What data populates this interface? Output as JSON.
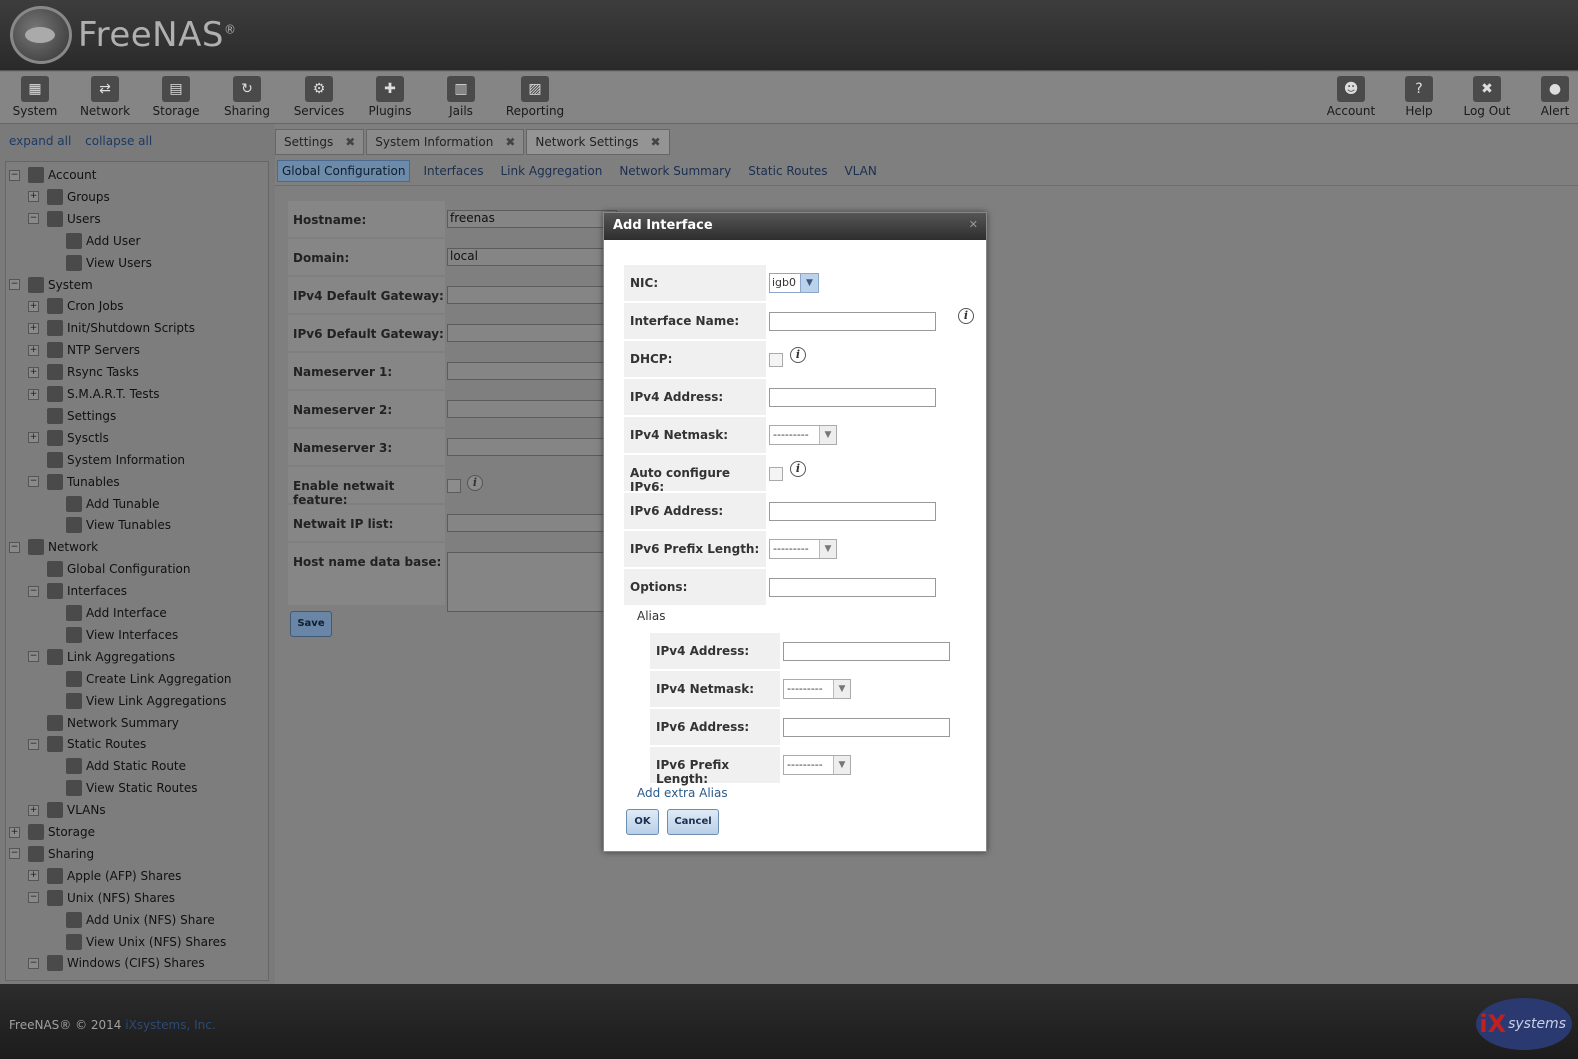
{
  "app": {
    "logo_text": "FreeNAS",
    "logo_reg": "®"
  },
  "topnav": {
    "left": [
      {
        "label": "System",
        "icon": "system-icon",
        "glyph": "▦"
      },
      {
        "label": "Network",
        "icon": "network-icon",
        "glyph": "⇄"
      },
      {
        "label": "Storage",
        "icon": "storage-icon",
        "glyph": "▤"
      },
      {
        "label": "Sharing",
        "icon": "sharing-icon",
        "glyph": "↻"
      },
      {
        "label": "Services",
        "icon": "services-icon",
        "glyph": "⚙"
      },
      {
        "label": "Plugins",
        "icon": "plugins-icon",
        "glyph": "✚"
      },
      {
        "label": "Jails",
        "icon": "jails-icon",
        "glyph": "▥"
      },
      {
        "label": "Reporting",
        "icon": "reporting-icon",
        "glyph": "▨"
      }
    ],
    "right": [
      {
        "label": "Account",
        "icon": "account-icon",
        "glyph": "☻"
      },
      {
        "label": "Help",
        "icon": "help-icon",
        "glyph": "?"
      },
      {
        "label": "Log Out",
        "icon": "logout-icon",
        "glyph": "✖"
      },
      {
        "label": "Alert",
        "icon": "alert-icon",
        "glyph": "●"
      }
    ]
  },
  "sidebar": {
    "expand_all": "expand all",
    "collapse_all": "collapse all",
    "tree": [
      {
        "label": "Account",
        "level": 0,
        "toggle": "−",
        "icon": "account-icon"
      },
      {
        "label": "Groups",
        "level": 1,
        "toggle": "+",
        "icon": "groups-icon"
      },
      {
        "label": "Users",
        "level": 1,
        "toggle": "−",
        "icon": "user-icon"
      },
      {
        "label": "Add User",
        "level": 2,
        "toggle": "",
        "icon": "add-user-icon"
      },
      {
        "label": "View Users",
        "level": 2,
        "toggle": "",
        "icon": "view-users-icon"
      },
      {
        "label": "System",
        "level": 0,
        "toggle": "−",
        "icon": "system-icon"
      },
      {
        "label": "Cron Jobs",
        "level": 1,
        "toggle": "+",
        "icon": "calendar-icon"
      },
      {
        "label": "Init/Shutdown Scripts",
        "level": 1,
        "toggle": "+",
        "icon": "scripts-icon"
      },
      {
        "label": "NTP Servers",
        "level": 1,
        "toggle": "+",
        "icon": "clock-icon"
      },
      {
        "label": "Rsync Tasks",
        "level": 1,
        "toggle": "+",
        "icon": "rsync-icon"
      },
      {
        "label": "S.M.A.R.T. Tests",
        "level": 1,
        "toggle": "+",
        "icon": "smart-icon"
      },
      {
        "label": "Settings",
        "level": 1,
        "toggle": "",
        "icon": "wrench-icon"
      },
      {
        "label": "Sysctls",
        "level": 1,
        "toggle": "+",
        "icon": "sysctl-icon"
      },
      {
        "label": "System Information",
        "level": 1,
        "toggle": "",
        "icon": "info-icon"
      },
      {
        "label": "Tunables",
        "level": 1,
        "toggle": "−",
        "icon": "tunables-icon"
      },
      {
        "label": "Add Tunable",
        "level": 2,
        "toggle": "",
        "icon": "add-tunable-icon"
      },
      {
        "label": "View Tunables",
        "level": 2,
        "toggle": "",
        "icon": "view-tunables-icon"
      },
      {
        "label": "Network",
        "level": 0,
        "toggle": "−",
        "icon": "network-icon"
      },
      {
        "label": "Global Configuration",
        "level": 1,
        "toggle": "",
        "icon": "wrench-icon"
      },
      {
        "label": "Interfaces",
        "level": 1,
        "toggle": "−",
        "icon": "interfaces-icon"
      },
      {
        "label": "Add Interface",
        "level": 2,
        "toggle": "",
        "icon": "add-interface-icon"
      },
      {
        "label": "View Interfaces",
        "level": 2,
        "toggle": "",
        "icon": "view-interfaces-icon"
      },
      {
        "label": "Link Aggregations",
        "level": 1,
        "toggle": "−",
        "icon": "link-aggregation-icon"
      },
      {
        "label": "Create Link Aggregation",
        "level": 2,
        "toggle": "",
        "icon": "create-lagg-icon"
      },
      {
        "label": "View Link Aggregations",
        "level": 2,
        "toggle": "",
        "icon": "view-lagg-icon"
      },
      {
        "label": "Network Summary",
        "level": 1,
        "toggle": "",
        "icon": "wrench-icon"
      },
      {
        "label": "Static Routes",
        "level": 1,
        "toggle": "−",
        "icon": "static-routes-icon"
      },
      {
        "label": "Add Static Route",
        "level": 2,
        "toggle": "",
        "icon": "add-route-icon"
      },
      {
        "label": "View Static Routes",
        "level": 2,
        "toggle": "",
        "icon": "view-routes-icon"
      },
      {
        "label": "VLANs",
        "level": 1,
        "toggle": "+",
        "icon": "vlan-icon"
      },
      {
        "label": "Storage",
        "level": 0,
        "toggle": "+",
        "icon": "storage-icon"
      },
      {
        "label": "Sharing",
        "level": 0,
        "toggle": "−",
        "icon": "sharing-icon"
      },
      {
        "label": "Apple (AFP) Shares",
        "level": 1,
        "toggle": "+",
        "icon": "apple-icon"
      },
      {
        "label": "Unix (NFS) Shares",
        "level": 1,
        "toggle": "−",
        "icon": "unix-icon"
      },
      {
        "label": "Add Unix (NFS) Share",
        "level": 2,
        "toggle": "",
        "icon": "add-nfs-icon"
      },
      {
        "label": "View Unix (NFS) Shares",
        "level": 2,
        "toggle": "",
        "icon": "view-nfs-icon"
      },
      {
        "label": "Windows (CIFS) Shares",
        "level": 1,
        "toggle": "−",
        "icon": "windows-icon"
      }
    ]
  },
  "tabs": [
    {
      "label": "Settings",
      "close": "✖"
    },
    {
      "label": "System Information",
      "close": "✖"
    },
    {
      "label": "Network Settings",
      "close": "✖"
    }
  ],
  "subtabs": [
    "Global Configuration",
    "Interfaces",
    "Link Aggregation",
    "Network Summary",
    "Static Routes",
    "VLAN"
  ],
  "global_config": {
    "fields": [
      {
        "label": "Hostname:",
        "value": "freenas"
      },
      {
        "label": "Domain:",
        "value": "local"
      },
      {
        "label": "IPv4 Default Gateway:",
        "value": ""
      },
      {
        "label": "IPv6 Default Gateway:",
        "value": ""
      },
      {
        "label": "Nameserver 1:",
        "value": ""
      },
      {
        "label": "Nameserver 2:",
        "value": ""
      },
      {
        "label": "Nameserver 3:",
        "value": ""
      },
      {
        "label": "Enable netwait feature:",
        "value": ""
      },
      {
        "label": "Netwait IP list:",
        "value": ""
      },
      {
        "label": "Host name data base:",
        "value": ""
      }
    ],
    "save_label": "Save",
    "info_glyph": "i"
  },
  "modal": {
    "title": "Add Interface",
    "close": "✕",
    "nic_label": "NIC:",
    "nic_value": "igb0",
    "interface_name_label": "Interface Name:",
    "dhcp_label": "DHCP:",
    "ipv4_address_label": "IPv4 Address:",
    "ipv4_netmask_label": "IPv4 Netmask:",
    "auto_ipv6_label": "Auto configure IPv6:",
    "ipv6_address_label": "IPv6 Address:",
    "ipv6_prefix_label": "IPv6 Prefix Length:",
    "options_label": "Options:",
    "select_placeholder": "---------",
    "arrow": "▼",
    "info_glyph": "i",
    "alias_legend": "Alias",
    "alias": {
      "ipv4_address_label": "IPv4 Address:",
      "ipv4_netmask_label": "IPv4 Netmask:",
      "ipv6_address_label": "IPv6 Address:",
      "ipv6_prefix_label": "IPv6 Prefix Length:"
    },
    "add_alias": "Add extra Alias",
    "ok_label": "OK",
    "cancel_label": "Cancel"
  },
  "footer": {
    "copyright": "FreeNAS® © 2014 ",
    "company": "iXsystems, Inc.",
    "ix_logo_ix": "iX",
    "ix_logo_text": "systems"
  }
}
